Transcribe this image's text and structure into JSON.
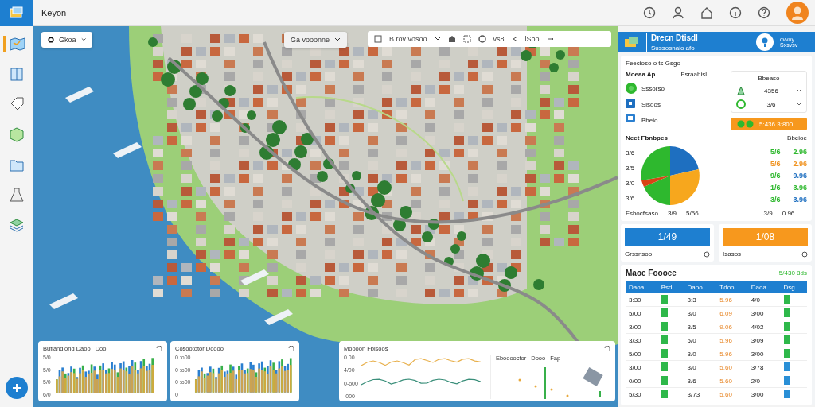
{
  "app": {
    "title": "Keyon"
  },
  "map": {
    "dropdown": {
      "label": "Gkoa"
    },
    "filter": {
      "label": "Ga vooonne"
    },
    "toolbar": {
      "select": "B rov vosoo",
      "search": "vs8",
      "link": "lSbo"
    },
    "charts": [
      {
        "kind": "bars",
        "title": "Buflandlond Daoo",
        "legend": "Doo",
        "ticks": [
          "5/0",
          "5/0",
          "5/0",
          "6/0"
        ]
      },
      {
        "kind": "bars",
        "title": "Cosoototor Doooo",
        "ticks": [
          "0 :o00",
          "0 :o00",
          "0 :o00",
          "0"
        ]
      },
      {
        "kind": "lines",
        "title": "Moooon Fbisoos",
        "ticks": [
          "0.00",
          "4/00",
          "0-o00",
          "-000"
        ],
        "side": {
          "title": "Eboooocfor",
          "legend": "Dooo",
          "legend_2": "Fap"
        }
      }
    ]
  },
  "panel": {
    "title": "Drecn Dtisdl",
    "subtitle": "Sussosnaio afo",
    "badge": "cvvoy Sxsvsv",
    "section": "Feecioso o ts Gsgo",
    "summary": {
      "heading": "Moeaa Ap",
      "heading_2": "Fsraahisl",
      "items": [
        {
          "label": "Sssorso"
        },
        {
          "label": "Sisdos"
        },
        {
          "label": "Bbeio"
        }
      ]
    },
    "mini": {
      "heading": "Bbeaso",
      "rows": [
        "4356",
        "3/6"
      ]
    },
    "highlight": "5:436 3:800",
    "breakdown": {
      "title": "Neet Fbnbpes",
      "legend_heading": "Bbeioe",
      "axis": [
        "3/6",
        "3/5",
        "3/0",
        "3/6"
      ],
      "rows": [
        {
          "values": [
            {
              "text": "5/6",
              "color": "#2eb82e"
            },
            {
              "text": "2.96",
              "color": "#2eb82e"
            }
          ]
        },
        {
          "values": [
            {
              "text": "5/6",
              "color": "#f0921e"
            },
            {
              "text": "2.96",
              "color": "#f0921e"
            }
          ]
        },
        {
          "values": [
            {
              "text": "9/6",
              "color": "#2eb82e"
            },
            {
              "text": "9.96",
              "color": "#1e6fc0"
            }
          ]
        },
        {
          "values": [
            {
              "text": "1/6",
              "color": "#2eb82e"
            },
            {
              "text": "3.96",
              "color": "#2eb82e"
            }
          ]
        },
        {
          "values": [
            {
              "text": "3/6",
              "color": "#2eb82e"
            },
            {
              "text": "3.96",
              "color": "#1e6fc0"
            }
          ]
        }
      ],
      "footer": [
        "Fsbocfsaso",
        "3/9",
        "5/56",
        "3/9",
        "0.96"
      ]
    },
    "kpis": [
      {
        "value": "1/49",
        "label": "Grssnsoo",
        "color": "#1e7fd0"
      },
      {
        "value": "1/08",
        "label": "Isasos",
        "color": "#f7981d"
      }
    ],
    "table": {
      "title": "Maoe Foooee",
      "total": "5/430 8ds",
      "columns": [
        "Daoa",
        "Bsd",
        "Daoo",
        "Tdoo",
        "Daoa",
        "Dsg"
      ],
      "rows": [
        {
          "cells": [
            "3:30",
            "",
            "3:3",
            "5.96",
            "4/0",
            ""
          ],
          "color": "#2eb84a"
        },
        {
          "cells": [
            "5/00",
            "",
            "3/0",
            "6.09",
            "3/00",
            ""
          ],
          "color": "#2eb84a"
        },
        {
          "cells": [
            "3/00",
            "",
            "3/5",
            "9.06",
            "4/02",
            ""
          ],
          "color": "#2eb84a"
        },
        {
          "cells": [
            "3/30",
            "",
            "5/0",
            "5.96",
            "3/09",
            ""
          ],
          "color": "#2eb84a"
        },
        {
          "cells": [
            "5/00",
            "",
            "3/0",
            "5.96",
            "3/00",
            ""
          ],
          "color": "#2eb84a"
        },
        {
          "cells": [
            "3/00",
            "",
            "3/0",
            "5.60",
            "3/78",
            ""
          ],
          "color": "#2a8fd6"
        },
        {
          "cells": [
            "0/00",
            "",
            "3/6",
            "5.60",
            "2/0",
            ""
          ],
          "color": "#2a8fd6"
        },
        {
          "cells": [
            "5/30",
            "",
            "3/73",
            "5.60",
            "3/00",
            ""
          ],
          "color": "#2a8fd6"
        }
      ]
    }
  }
}
